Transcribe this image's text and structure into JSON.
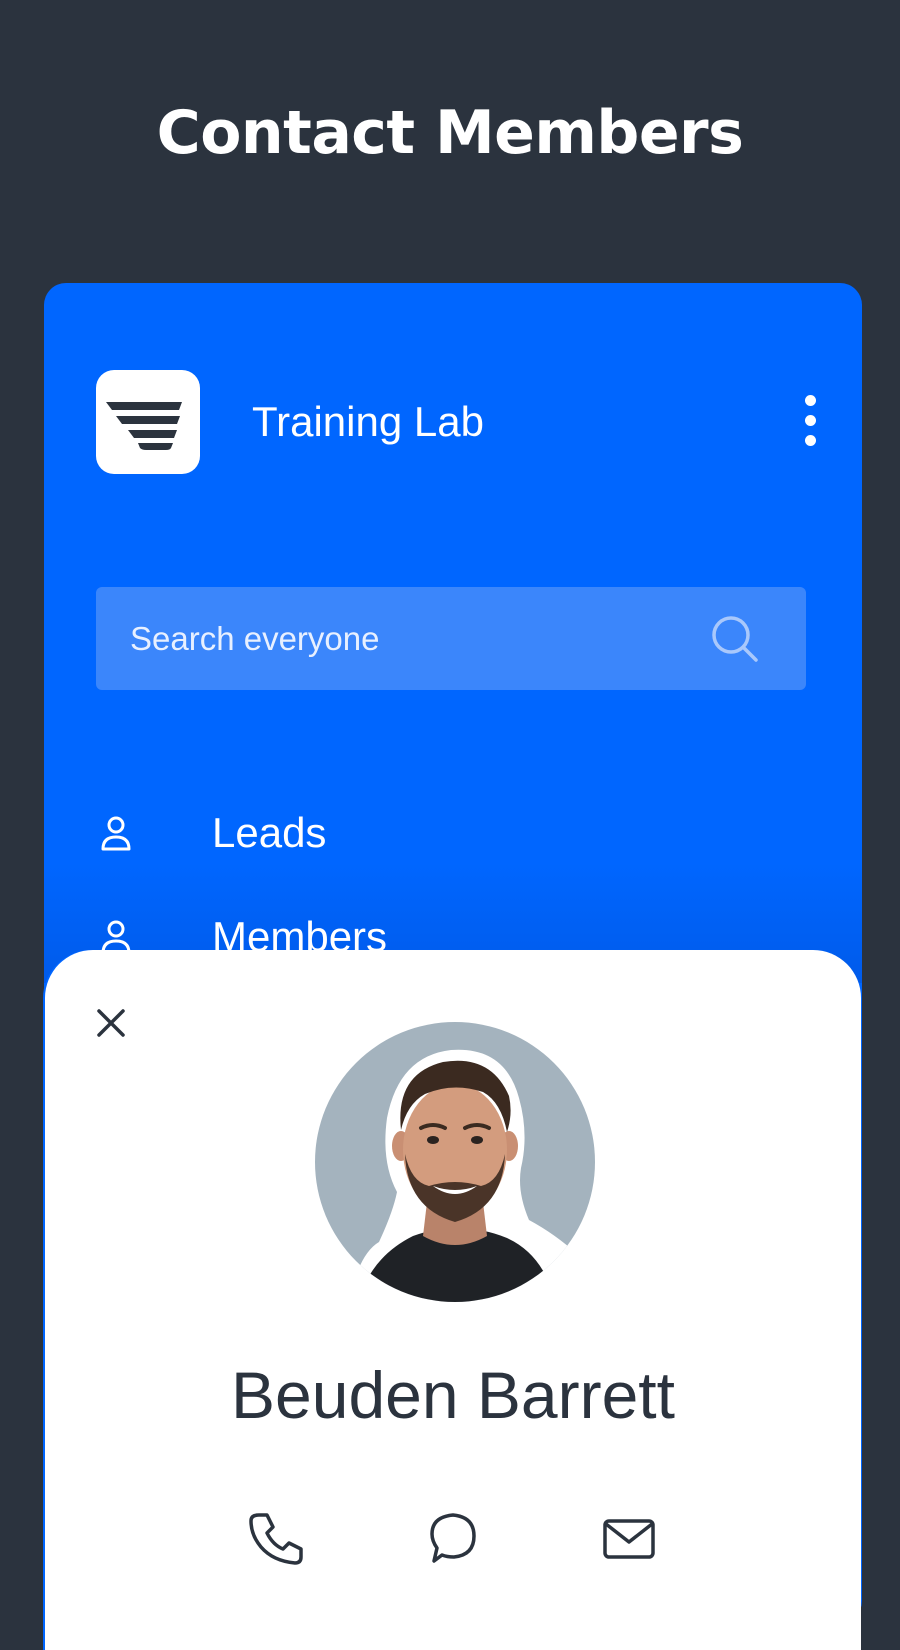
{
  "header": {
    "title": "Contact Members"
  },
  "app": {
    "org_name": "Training Lab",
    "logo_icon": "training-lab-logo",
    "menu_icon": "more-vertical-icon"
  },
  "search": {
    "placeholder": "Search everyone",
    "value": "",
    "icon": "search-icon"
  },
  "nav": {
    "items": [
      {
        "label": "Leads",
        "icon": "person-icon"
      },
      {
        "label": "Members",
        "icon": "person-icon"
      }
    ]
  },
  "contact_sheet": {
    "name": "Beuden Barrett",
    "close_icon": "close-icon",
    "avatar": "avatar-photo",
    "actions": [
      {
        "name": "call",
        "icon": "phone-icon"
      },
      {
        "name": "message",
        "icon": "chat-bubble-icon"
      },
      {
        "name": "email",
        "icon": "mail-icon"
      }
    ]
  },
  "colors": {
    "page_background": "#2b333e",
    "card_blue": "#0066ff",
    "search_field": "#3b86fb",
    "sheet_background": "#ffffff",
    "text_dark": "#2b333e",
    "avatar_background": "#a4b3be"
  }
}
